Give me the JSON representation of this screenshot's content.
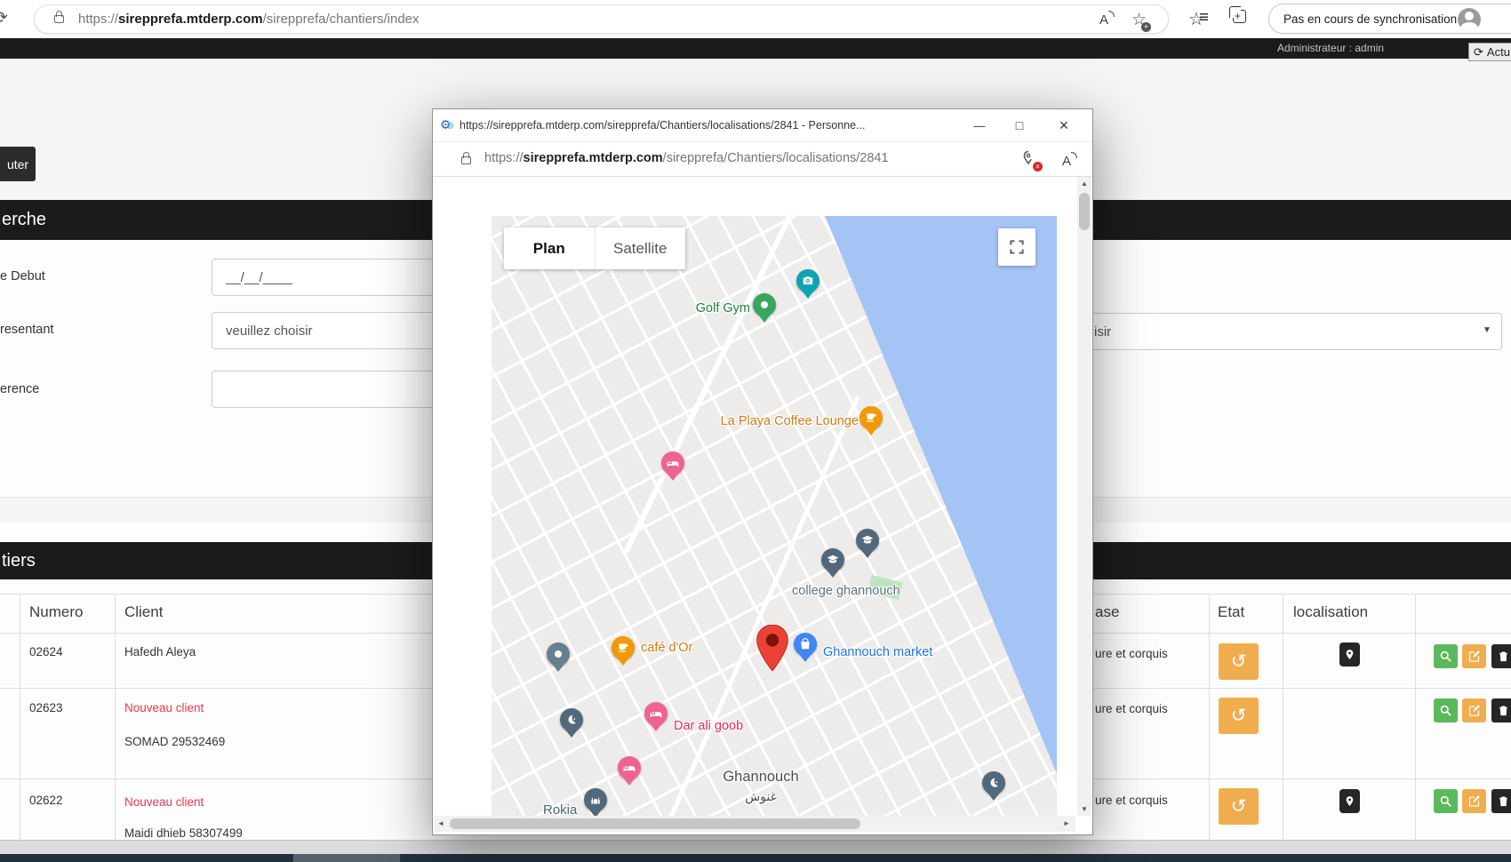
{
  "icons": {
    "reload": "⟳",
    "read_aloud": "A",
    "star": "☆",
    "plus": "+",
    "undo": "↺",
    "gear": "⚙",
    "up": "▲",
    "down": "▼",
    "left": "◄",
    "right": "►",
    "dropdown": "▼",
    "minimize": "—",
    "maximize": "□",
    "close": "×"
  },
  "browser": {
    "url_prefix": "https://",
    "url_domain": "sirepprefa.mtderp.com",
    "url_path": "/sirepprefa/chantiers/index",
    "sync_button": "Pas en cours de synchronisation"
  },
  "appbar": {
    "admin": "Administrateur : admin",
    "refresh": "Actu"
  },
  "page": {
    "add_button": "uter",
    "search": {
      "title": "erche",
      "date_label": "e Debut",
      "date_placeholder": "__/__/____",
      "rep_label": "resentant",
      "rep_value": "veuillez choisir",
      "ref_label": "erence",
      "right_select_visible": "isir"
    },
    "table": {
      "title": "tiers",
      "columns": {
        "numero": "Numero",
        "client": "Client",
        "phase": "ase",
        "etat": "Etat",
        "localisation": "localisation"
      },
      "rows": [
        {
          "numero": "02624",
          "client": "Hafedh Aleya",
          "client2": "",
          "phase": "ure et corquis"
        },
        {
          "numero": "02623",
          "client": "Nouveau client",
          "client2": "SOMAD 29532469",
          "phase": "ure et corquis"
        },
        {
          "numero": "02622",
          "client": "Nouveau client",
          "client2": "Maidi dhieb 58307499",
          "phase": "ure et corquis"
        }
      ]
    }
  },
  "popup": {
    "title": "https://sirepprefa.mtderp.com/sirepprefa/Chantiers/localisations/2841 - Personne...",
    "url_prefix": "https://",
    "url_domain": "sirepprefa.mtderp.com",
    "url_path": "/sirepprefa/Chantiers/localisations/2841",
    "map": {
      "plan": "Plan",
      "satellite": "Satellite",
      "labels": {
        "golf_gym": "Golf Gym",
        "la_playa": "La Playa Coffee Lounge",
        "college": "college ghannouch",
        "cafe_dor": "café d'Or",
        "market": "Ghannouch market",
        "dar_ali": "Dar ali goob",
        "city": "Ghannouch",
        "city_ar": "غنوش",
        "rokia": "Rokia"
      }
    }
  },
  "colors": {
    "accent_orange": "#F0AD4E",
    "accent_green": "#5CB85C",
    "dark_button": "#262626",
    "red_text": "#E8384F",
    "water": "#A4C4F6",
    "bar_black": "#1B1B1B"
  }
}
